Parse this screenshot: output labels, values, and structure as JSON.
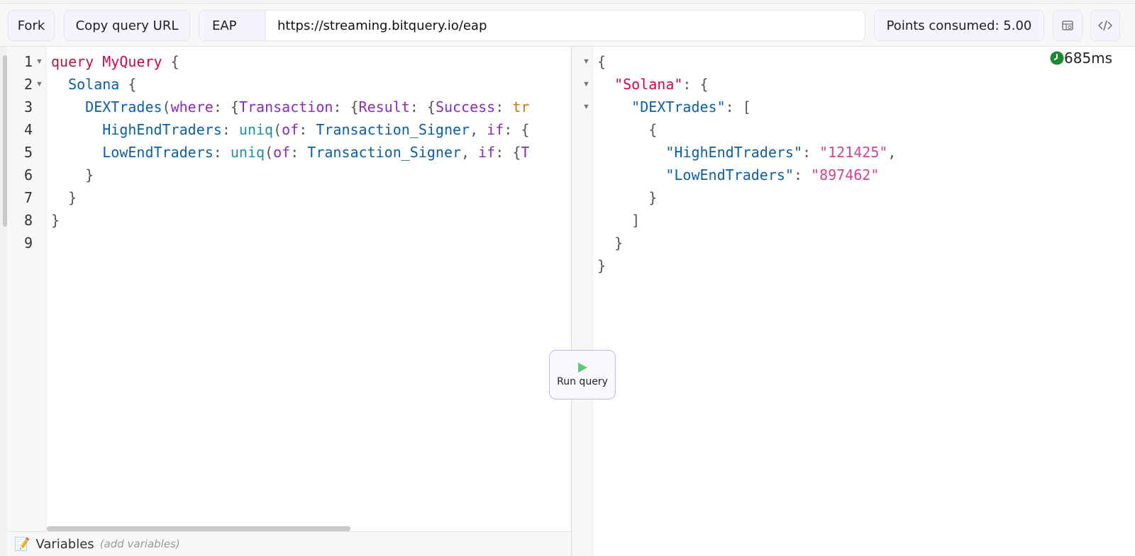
{
  "toolbar": {
    "fork_label": "Fork",
    "copy_url_label": "Copy query URL",
    "endpoint_prefix": "EAP",
    "endpoint_url": "https://streaming.bitquery.io/eap",
    "points_label": "Points consumed: 5.00",
    "icons": [
      "table-icon",
      "code-icon"
    ]
  },
  "editor": {
    "line_numbers": [
      "1",
      "2",
      "3",
      "4",
      "5",
      "6",
      "7",
      "8",
      "9"
    ],
    "lines": {
      "l1": {
        "keyword": "query",
        "name": "MyQuery",
        "brace": "{"
      },
      "l2": {
        "field": "Solana",
        "brace": "{"
      },
      "l3": {
        "field": "DEXTrades",
        "open": "(",
        "arg": "where",
        "colon": ":",
        "b1": "{",
        "f1": "Transaction",
        "b2": "{",
        "f2": "Result",
        "b3": "{",
        "f3": "Success",
        "val": "tr"
      },
      "l4": {
        "field": "HighEndTraders",
        "colon": ":",
        "fn": "uniq",
        "open": "(",
        "arg": "of",
        "type": "Transaction_Signer",
        "comma": ",",
        "arg2": "if",
        "tail": "{"
      },
      "l5": {
        "field": "LowEndTraders",
        "colon": ":",
        "fn": "uniq",
        "open": "(",
        "arg": "of",
        "type": "Transaction_Signer",
        "comma": ",",
        "arg2": "if",
        "tail": "{",
        "tail_type": "T"
      },
      "l6": "}",
      "l7": "}",
      "l8": "}"
    }
  },
  "variables": {
    "icon": "📝",
    "title": "Variables",
    "hint": "(add variables)"
  },
  "run_button": {
    "label": "Run query",
    "icon": "play-icon",
    "color": "#5cc87a"
  },
  "result": {
    "timing": "685ms",
    "solana_key": "\"Solana\"",
    "dex_key": "\"DEXTrades\"",
    "high_key": "\"HighEndTraders\"",
    "high_val": "\"121425\"",
    "low_key": "\"LowEndTraders\"",
    "low_val": "\"897462\""
  },
  "colors": {
    "accent": "#c8b5ef",
    "keyword": "#b11a3b",
    "string": "#d64292",
    "field": "#0b5fa5",
    "timer_green": "#1a8a2e"
  }
}
